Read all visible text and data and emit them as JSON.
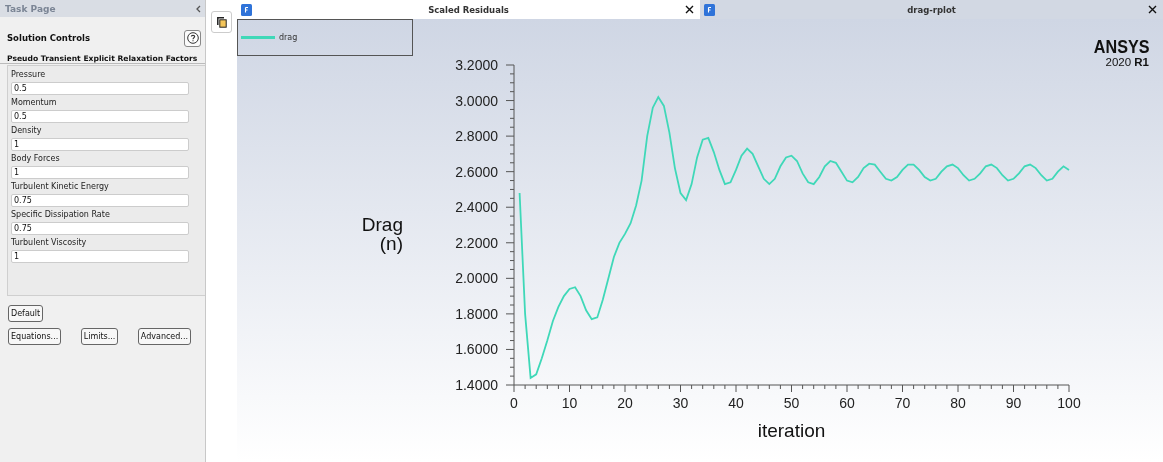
{
  "task_page": {
    "title": "Task Page",
    "heading": "Solution Controls",
    "group_title": "Pseudo Transient Explicit Relaxation Factors",
    "fields": [
      {
        "label": "Pressure",
        "value": "0.5"
      },
      {
        "label": "Momentum",
        "value": "0.5"
      },
      {
        "label": "Density",
        "value": "1"
      },
      {
        "label": "Body Forces",
        "value": "1"
      },
      {
        "label": "Turbulent Kinetic Energy",
        "value": "0.75"
      },
      {
        "label": "Specific Dissipation Rate",
        "value": "0.75"
      },
      {
        "label": "Turbulent Viscosity",
        "value": "1"
      }
    ],
    "default_button": "Default",
    "buttons": [
      "Equations...",
      "Limits...",
      "Advanced..."
    ]
  },
  "tabs": [
    {
      "title": "Scaled Residuals",
      "selected": true
    },
    {
      "title": "drag-rplot",
      "selected": false
    }
  ],
  "plot": {
    "logo": {
      "name": "ANSYS",
      "version": "2020 **R1**"
    },
    "chart_data": {
      "type": "line",
      "xlabel": "iteration",
      "ylabel": "Drag (n)",
      "xlim": [
        0,
        100
      ],
      "ylim": [
        1.4,
        3.2
      ],
      "xticks": [
        0,
        10,
        20,
        30,
        40,
        50,
        60,
        70,
        80,
        90,
        100
      ],
      "yticks": [
        {
          "value": 1.4,
          "label": "1.4000"
        },
        {
          "value": 1.6,
          "label": "1.6000"
        },
        {
          "value": 1.8,
          "label": "1.8000"
        },
        {
          "value": 2.0,
          "label": "2.0000"
        },
        {
          "value": 2.2,
          "label": "2.2000"
        },
        {
          "value": 2.4,
          "label": "2.4000"
        },
        {
          "value": 2.6,
          "label": "2.6000"
        },
        {
          "value": 2.8,
          "label": "2.8000"
        },
        {
          "value": 3.0,
          "label": "3.0000"
        },
        {
          "value": 3.2,
          "label": "3.2000"
        }
      ],
      "x": [
        1,
        2,
        3,
        4,
        5,
        6,
        7,
        8,
        9,
        10,
        11,
        12,
        13,
        14,
        15,
        16,
        17,
        18,
        19,
        20,
        21,
        22,
        23,
        24,
        25,
        26,
        27,
        28,
        29,
        30,
        31,
        32,
        33,
        34,
        35,
        36,
        37,
        38,
        39,
        40,
        41,
        42,
        43,
        44,
        45,
        46,
        47,
        48,
        49,
        50,
        51,
        52,
        53,
        54,
        55,
        56,
        57,
        58,
        59,
        60,
        61,
        62,
        63,
        64,
        65,
        66,
        67,
        68,
        69,
        70,
        71,
        72,
        73,
        74,
        75,
        76,
        77,
        78,
        79,
        80,
        81,
        82,
        83,
        84,
        85,
        86,
        87,
        88,
        89,
        90,
        91,
        92,
        93,
        94,
        95,
        96,
        97,
        98,
        99,
        100
      ],
      "series": [
        {
          "name": "drag",
          "color": "#3fd8b8",
          "values": [
            2.48,
            1.8,
            1.44,
            1.46,
            1.55,
            1.65,
            1.76,
            1.84,
            1.9,
            1.94,
            1.95,
            1.9,
            1.82,
            1.77,
            1.78,
            1.88,
            2.0,
            2.12,
            2.2,
            2.25,
            2.31,
            2.41,
            2.55,
            2.8,
            2.96,
            3.02,
            2.97,
            2.82,
            2.62,
            2.48,
            2.44,
            2.53,
            2.68,
            2.78,
            2.79,
            2.71,
            2.61,
            2.53,
            2.54,
            2.61,
            2.69,
            2.73,
            2.7,
            2.63,
            2.56,
            2.53,
            2.56,
            2.63,
            2.68,
            2.69,
            2.66,
            2.59,
            2.54,
            2.53,
            2.57,
            2.63,
            2.66,
            2.65,
            2.6,
            2.55,
            2.54,
            2.57,
            2.62,
            2.645,
            2.64,
            2.6,
            2.56,
            2.55,
            2.57,
            2.61,
            2.64,
            2.64,
            2.61,
            2.57,
            2.55,
            2.56,
            2.6,
            2.63,
            2.64,
            2.62,
            2.58,
            2.55,
            2.56,
            2.59,
            2.63,
            2.64,
            2.62,
            2.58,
            2.55,
            2.56,
            2.59,
            2.63,
            2.64,
            2.62,
            2.58,
            2.55,
            2.56,
            2.6,
            2.63,
            2.61
          ]
        }
      ]
    }
  }
}
